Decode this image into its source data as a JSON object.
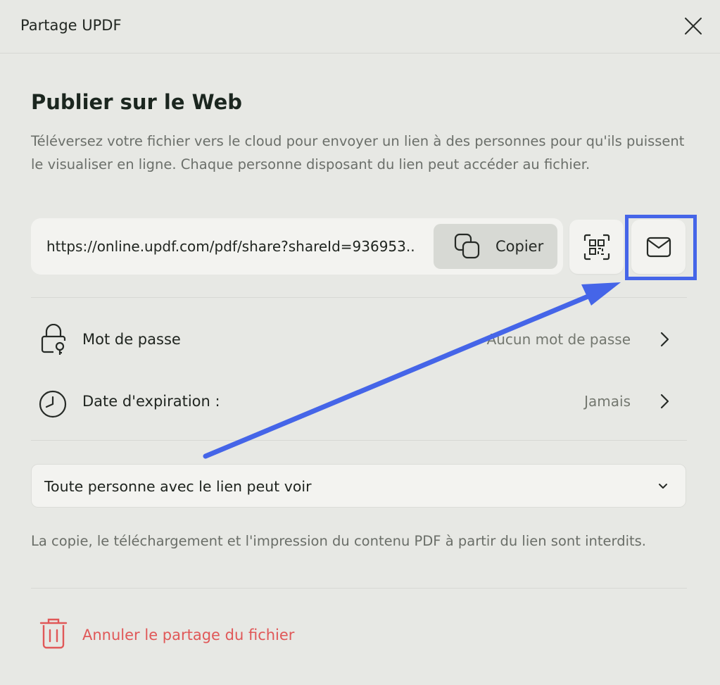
{
  "window": {
    "title": "Partage UPDF"
  },
  "publish": {
    "heading": "Publier sur le Web",
    "description": "Téléversez votre fichier vers le cloud pour envoyer un lien à des personnes pour qu'ils puissent le visualiser en ligne. Chaque personne disposant du lien peut accéder au fichier.",
    "link_url": "https://online.updf.com/pdf/share?shareId=936953..",
    "copy_label": "Copier"
  },
  "settings": {
    "password": {
      "label": "Mot de passe",
      "value": "Aucun mot de passe"
    },
    "expiration": {
      "label": "Date d'expiration :",
      "value": "Jamais"
    }
  },
  "permission": {
    "selected": "Toute personne avec le lien peut voir"
  },
  "note": "La copie, le téléchargement et l'impression du contenu PDF à partir du lien sont interdits.",
  "cancel_share_label": "Annuler le partage du fichier",
  "colors": {
    "background": "#e7e8e4",
    "accent_highlight": "#4565e8",
    "danger": "#e05858"
  }
}
